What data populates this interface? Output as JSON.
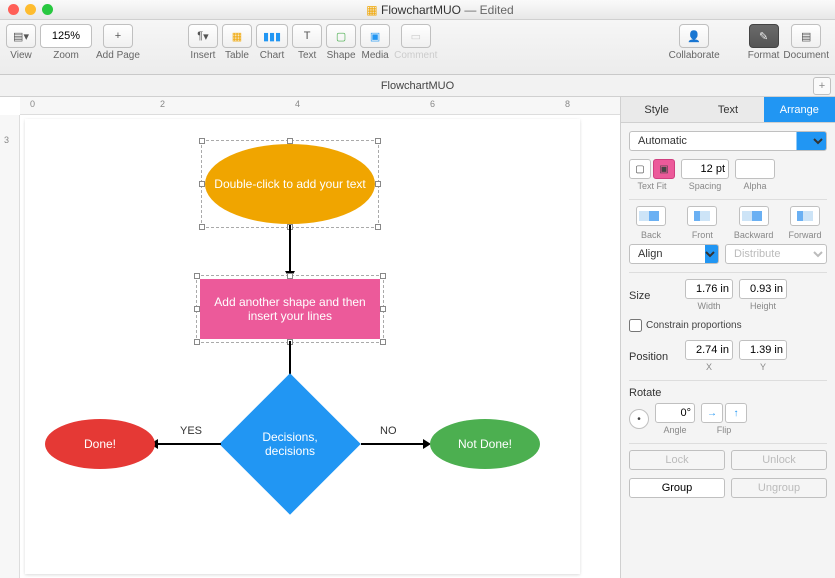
{
  "titlebar": {
    "doc_name": "FlowchartMUO",
    "status": "Edited",
    "pages_icon": "▦"
  },
  "toolbar": {
    "view": {
      "label": "View",
      "icon": "▾"
    },
    "zoom": {
      "label": "Zoom",
      "value": "125%"
    },
    "add_page": {
      "label": "Add Page",
      "icon": "+"
    },
    "insert": {
      "label": "Insert",
      "icon": "¶"
    },
    "table": {
      "label": "Table"
    },
    "chart": {
      "label": "Chart"
    },
    "text": {
      "label": "Text",
      "icon": "T"
    },
    "shape": {
      "label": "Shape"
    },
    "media": {
      "label": "Media"
    },
    "comment": {
      "label": "Comment"
    },
    "collaborate": {
      "label": "Collaborate"
    },
    "format": {
      "label": "Format"
    },
    "document": {
      "label": "Document"
    }
  },
  "doctab": {
    "name": "FlowchartMUO",
    "plus": "+"
  },
  "ruler": {
    "m0": "0",
    "m2": "2",
    "m4": "4",
    "m6": "6",
    "m8": "8",
    "v3": "3"
  },
  "flowchart": {
    "oval1": "Double-click to add your text",
    "rect1": "Add another shape and then insert your lines",
    "diamond": "Decisions, decisions",
    "oval2": "Done!",
    "oval3": "Not Done!",
    "yes": "YES",
    "no": "NO"
  },
  "inspector": {
    "tabs": {
      "style": "Style",
      "text": "Text",
      "arrange": "Arrange"
    },
    "wrap_select": "Automatic",
    "text_fit": "Text Fit",
    "spacing": {
      "label": "Spacing",
      "value": "12 pt"
    },
    "alpha": "Alpha",
    "back": "Back",
    "front": "Front",
    "backward": "Backward",
    "forward": "Forward",
    "align": {
      "label": "Align"
    },
    "distribute": "Distribute",
    "size": {
      "label": "Size",
      "width": "1.76 in",
      "height": "0.93 in",
      "wlabel": "Width",
      "hlabel": "Height"
    },
    "constrain": "Constrain proportions",
    "position": {
      "label": "Position",
      "x": "2.74 in",
      "y": "1.39 in",
      "xlabel": "X",
      "ylabel": "Y"
    },
    "rotate": {
      "label": "Rotate",
      "angle": "0°",
      "alabel": "Angle",
      "flip": "Flip"
    },
    "lock": "Lock",
    "unlock": "Unlock",
    "group": "Group",
    "ungroup": "Ungroup"
  }
}
